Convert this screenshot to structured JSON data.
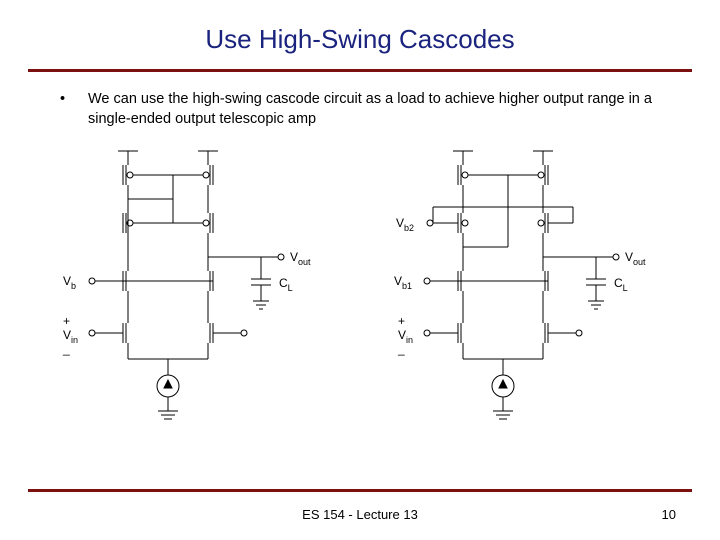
{
  "title": "Use High-Swing Cascodes",
  "bullet_text": "We can use the high-swing cascode circuit as a load to achieve higher output range in a single-ended output telescopic amp",
  "labels": {
    "vb": "V",
    "vb_s": "b",
    "vb1": "V",
    "vb1_s": "b1",
    "vb2": "V",
    "vb2_s": "b2",
    "vin": "V",
    "vin_s": "in",
    "vout": "V",
    "vout_s": "out",
    "cl": "C",
    "cl_s": "L",
    "plus": "+",
    "minus": "_"
  },
  "footer": "ES 154 - Lecture 13",
  "page": "10"
}
